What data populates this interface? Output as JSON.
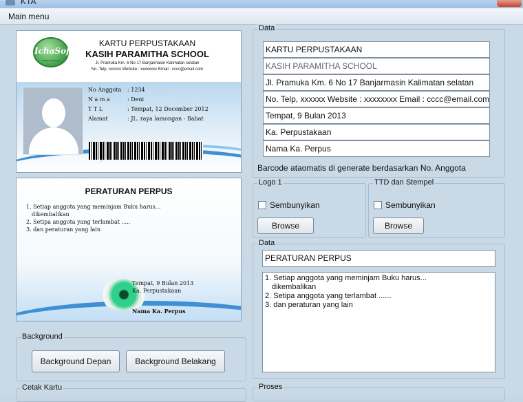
{
  "window": {
    "title": "KTA"
  },
  "menu": {
    "main": "Main menu"
  },
  "card_front": {
    "logo_text": "IchaSoft",
    "logo_sub": "Software Developer",
    "title1": "KARTU PERPUSTAKAAN",
    "title2": "KASIH PARAMITHA SCHOOL",
    "address1": "Jl. Pramuka Km. 6 No 17 Banjarmasin Kalimatan selatan",
    "address2": "No. Telp, xxxxxx Website : xxxxxxxx Email : cccc@email.com",
    "fields": [
      {
        "label": "No Anggota",
        "value": ": 1234"
      },
      {
        "label": "N a m a",
        "value": ": Deni"
      },
      {
        "label": "T T L",
        "value": ": Tempat, 12 December 2012"
      },
      {
        "label": "Alamat",
        "value": ": JL. raya lamongan - Babat"
      }
    ]
  },
  "card_back": {
    "title": "PERATURAN PERPUS",
    "rules": [
      "1. Setiap anggota yang meminjam Buku harus...",
      "    dikembalikan",
      "2. Setipa anggota yang terlambat .....",
      "3. dan peraturan yang lain"
    ],
    "sign_place": "Tempat, 9 Bulan 2013",
    "sign_role": "Ka. Perpustakaan",
    "sign_name": "Nama Ka. Perpus"
  },
  "data_panel": {
    "label": "Data",
    "fields": [
      "KARTU PERPUSTAKAAN",
      "KASIH PARAMITHA SCHOOL",
      "Jl. Pramuka Km. 6 No 17 Banjarmasin Kalimatan selatan",
      "No. Telp, xxxxxx Website : xxxxxxxx Email : cccc@email.com",
      "Tempat, 9 Bulan 2013",
      "Ka. Perpustakaan",
      "Nama Ka. Perpus"
    ],
    "barcode_note": "Barcode ataomatis di generate berdasarkan No. Anggota"
  },
  "logo1": {
    "label": "Logo 1",
    "checkbox": "Sembunyikan",
    "browse": "Browse"
  },
  "ttd": {
    "label": "TTD dan Stempel",
    "checkbox": "Sembunyikan",
    "browse": "Browse"
  },
  "data2": {
    "label": "Data",
    "title_value": "PERATURAN PERPUS",
    "rules_lines": [
      "1. Setiap anggota yang meminjam Buku harus...",
      "    dikembalikan",
      "2. Setipa anggota yang terlambat ......",
      "3. dan peraturan yang lain"
    ]
  },
  "background": {
    "label": "Background",
    "front": "Background Depan",
    "back": "Background Belakang"
  },
  "cetak": {
    "label": "Cetak Kartu"
  },
  "proses": {
    "label": "Proses"
  },
  "colors": {
    "window_bg": "#c9d9e6",
    "swoosh": "#3e8fd4"
  }
}
